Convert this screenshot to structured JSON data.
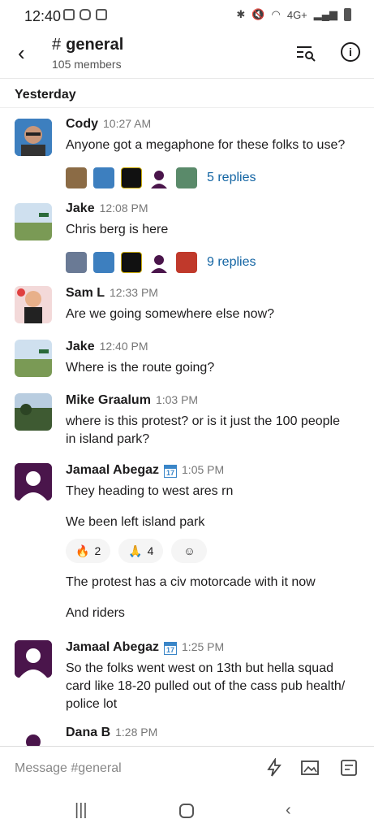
{
  "status": {
    "time": "12:40",
    "network": "4G+"
  },
  "header": {
    "back_icon": "back-arrow-icon",
    "hash": "#",
    "channel": "general",
    "members": "105 members"
  },
  "day_divider": "Yesterday",
  "messages": [
    {
      "name": "Cody",
      "time": "10:27 AM",
      "text": "Anyone got a megaphone for these folks to use?",
      "replies": "5 replies"
    },
    {
      "name": "Jake",
      "time": "12:08 PM",
      "text": "Chris berg is here",
      "replies": "9 replies"
    },
    {
      "name": "Sam L",
      "time": "12:33 PM",
      "text": "Are we going somewhere else now?"
    },
    {
      "name": "Jake",
      "time": "12:40 PM",
      "text": "Where is the route going?"
    },
    {
      "name": "Mike Graalum",
      "time": "1:03 PM",
      "text1": "where is this protest?  or is it just the 100 people",
      "text2": "in island park?"
    },
    {
      "name": "Jamaal Abegaz",
      "cal": "17",
      "time": "1:05 PM",
      "text1": "They heading to west ares rn",
      "text2": "We been left island park",
      "react_fire_count": "2",
      "react_pray_count": "4",
      "text3": "The protest has a civ motorcade with it now",
      "text4": "And riders"
    },
    {
      "name": "Jamaal Abegaz",
      "cal": "17",
      "time": "1:25 PM",
      "text1": "So the folks went west on 13th but hella squad",
      "text2": "card like 18-20 pulled out of the cass pub health/",
      "text3": "police lot"
    },
    {
      "name": "Dana B",
      "time": "1:28 PM"
    }
  ],
  "composer": {
    "placeholder": "Message #general"
  },
  "colors": {
    "link": "#1264a3",
    "purple": "#4a154b"
  }
}
